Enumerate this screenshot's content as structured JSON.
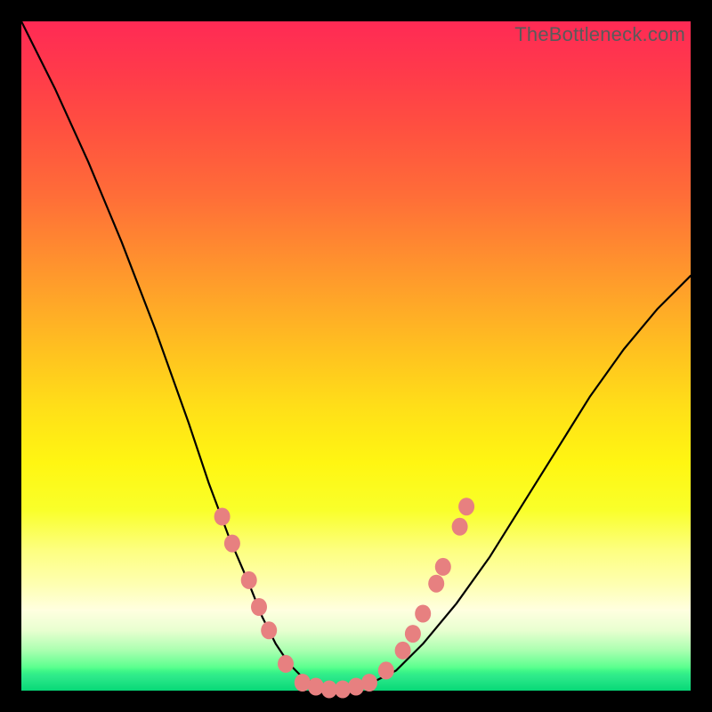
{
  "watermark": "TheBottleneck.com",
  "colors": {
    "dot": "#e78080",
    "line": "#000000",
    "gradient_top": "#ff2a55",
    "gradient_bottom": "#07e37a"
  },
  "chart_data": {
    "type": "line",
    "title": "",
    "xlabel": "",
    "ylabel": "",
    "xlim": [
      0,
      100
    ],
    "ylim": [
      0,
      100
    ],
    "grid": false,
    "legend": false,
    "note": "Bottleneck-style V-curve. x is relative position across plot (0 left, 100 right). y is bottleneck-percent (0 at floor, 100 at top). Values estimated from the image; no numeric axes present.",
    "series": [
      {
        "name": "curve",
        "x": [
          0,
          5,
          10,
          15,
          20,
          25,
          28,
          31,
          34,
          36,
          38,
          40,
          42,
          44,
          46,
          48,
          50,
          52,
          56,
          60,
          65,
          70,
          75,
          80,
          85,
          90,
          95,
          100
        ],
        "y": [
          100,
          90,
          79,
          67,
          54,
          40,
          31,
          23,
          16,
          11,
          7,
          4,
          2,
          1,
          0,
          0,
          0,
          1,
          3,
          7,
          13,
          20,
          28,
          36,
          44,
          51,
          57,
          62
        ]
      }
    ],
    "markers": [
      {
        "name": "left-dot-1",
        "x": 30.0,
        "y": 26.0
      },
      {
        "name": "left-dot-2",
        "x": 31.5,
        "y": 22.0
      },
      {
        "name": "left-dot-3",
        "x": 34.0,
        "y": 16.5
      },
      {
        "name": "left-dot-4",
        "x": 35.5,
        "y": 12.5
      },
      {
        "name": "left-dot-5",
        "x": 37.0,
        "y": 9.0
      },
      {
        "name": "left-dot-6",
        "x": 39.5,
        "y": 4.0
      },
      {
        "name": "floor-dot-1",
        "x": 42.0,
        "y": 1.2
      },
      {
        "name": "floor-dot-2",
        "x": 44.0,
        "y": 0.6
      },
      {
        "name": "floor-dot-3",
        "x": 46.0,
        "y": 0.2
      },
      {
        "name": "floor-dot-4",
        "x": 48.0,
        "y": 0.2
      },
      {
        "name": "floor-dot-5",
        "x": 50.0,
        "y": 0.6
      },
      {
        "name": "floor-dot-6",
        "x": 52.0,
        "y": 1.2
      },
      {
        "name": "right-dot-1",
        "x": 54.5,
        "y": 3.0
      },
      {
        "name": "right-dot-2",
        "x": 57.0,
        "y": 6.0
      },
      {
        "name": "right-dot-3",
        "x": 58.5,
        "y": 8.5
      },
      {
        "name": "right-dot-4",
        "x": 60.0,
        "y": 11.5
      },
      {
        "name": "right-dot-5",
        "x": 62.0,
        "y": 16.0
      },
      {
        "name": "right-dot-6",
        "x": 63.0,
        "y": 18.5
      },
      {
        "name": "right-dot-7",
        "x": 65.5,
        "y": 24.5
      },
      {
        "name": "right-dot-8",
        "x": 66.5,
        "y": 27.5
      }
    ]
  }
}
